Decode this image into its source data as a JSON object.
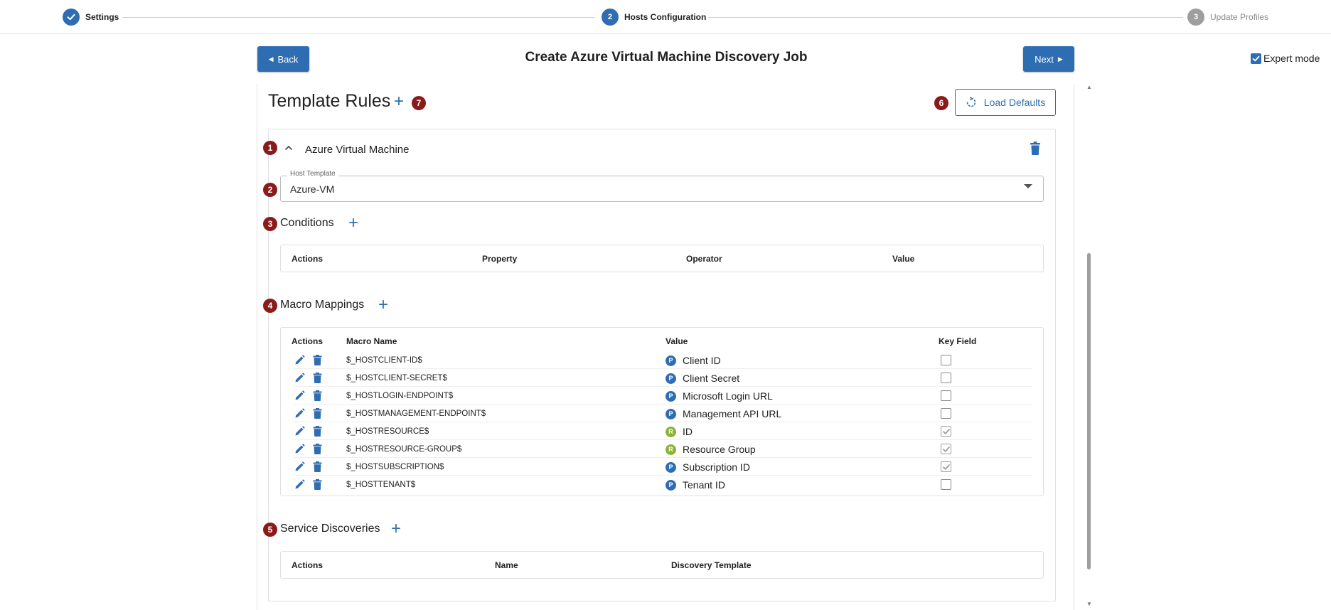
{
  "stepper": {
    "steps": [
      {
        "number": "",
        "label": "Settings",
        "state": "done"
      },
      {
        "number": "2",
        "label": "Hosts Configuration",
        "state": "active"
      },
      {
        "number": "3",
        "label": "Update Profiles",
        "state": "inactive"
      }
    ]
  },
  "header": {
    "back_label": "Back",
    "title": "Create Azure Virtual Machine Discovery Job",
    "next_label": "Next",
    "expert_mode_label": "Expert mode",
    "expert_mode_checked": true
  },
  "template_rules": {
    "title": "Template Rules",
    "load_defaults_label": "Load Defaults",
    "badges": {
      "collapse": "1",
      "host_template": "2",
      "conditions": "3",
      "macro_mappings": "4",
      "service_discoveries": "5",
      "load_defaults": "6",
      "add_rule": "7"
    }
  },
  "rule": {
    "name": "Azure Virtual Machine",
    "host_template": {
      "legend": "Host Template",
      "value": "Azure-VM"
    },
    "conditions": {
      "title": "Conditions",
      "columns": [
        "Actions",
        "Property",
        "Operator",
        "Value"
      ]
    },
    "macro_mappings": {
      "title": "Macro Mappings",
      "columns": [
        "Actions",
        "Macro Name",
        "Value",
        "Key Field"
      ],
      "rows": [
        {
          "macro": "$_HOSTCLIENT-ID$",
          "badge": "P",
          "value": "Client ID",
          "key": false
        },
        {
          "macro": "$_HOSTCLIENT-SECRET$",
          "badge": "P",
          "value": "Client Secret",
          "key": false
        },
        {
          "macro": "$_HOSTLOGIN-ENDPOINT$",
          "badge": "P",
          "value": "Microsoft Login URL",
          "key": false
        },
        {
          "macro": "$_HOSTMANAGEMENT-ENDPOINT$",
          "badge": "P",
          "value": "Management API URL",
          "key": false
        },
        {
          "macro": "$_HOSTRESOURCE$",
          "badge": "R",
          "value": "ID",
          "key": true
        },
        {
          "macro": "$_HOSTRESOURCE-GROUP$",
          "badge": "R",
          "value": "Resource Group",
          "key": true
        },
        {
          "macro": "$_HOSTSUBSCRIPTION$",
          "badge": "P",
          "value": "Subscription ID",
          "key": true
        },
        {
          "macro": "$_HOSTTENANT$",
          "badge": "P",
          "value": "Tenant ID",
          "key": false
        }
      ]
    },
    "service_discoveries": {
      "title": "Service Discoveries",
      "columns": [
        "Actions",
        "Name",
        "Discovery Template"
      ]
    }
  },
  "colors": {
    "primary": "#2f6db3",
    "badge_red": "#8b1a1a",
    "badge_p": "#2f6db3",
    "badge_r": "#8bb33a",
    "inactive_step": "#9e9e9e"
  }
}
